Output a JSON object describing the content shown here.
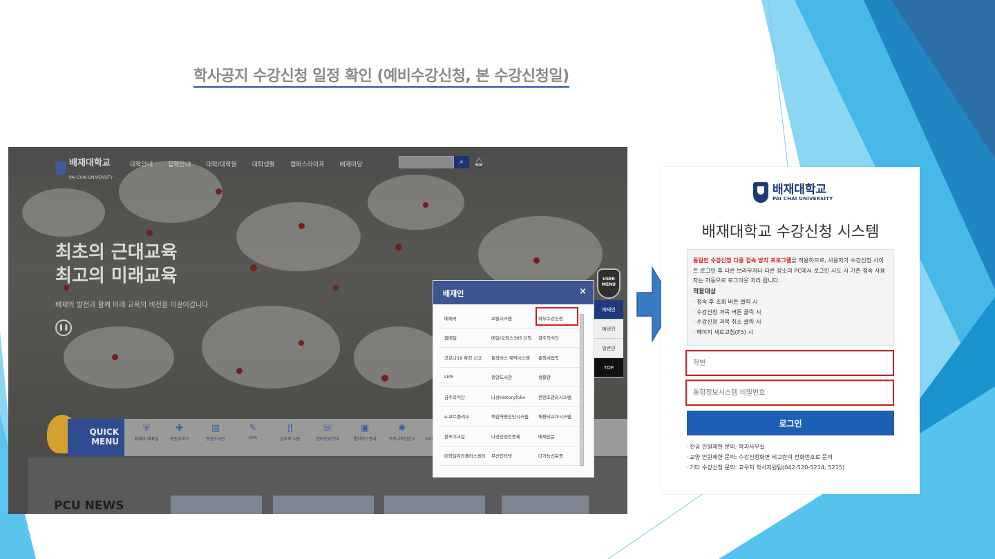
{
  "slide": {
    "title": "학사공지 수강신청 일정 확인 (예비수강신청, 본 수강신청일)"
  },
  "homepage": {
    "logo_name": "배재대학교",
    "logo_sub": "PAI CHAI UNIVERSITY",
    "nav": [
      "대학안내",
      "입학안내",
      "대학/대학원",
      "대학생활",
      "캠퍼스라이프",
      "배재마당"
    ],
    "hero_line1": "최초의 근대교육",
    "hero_line2": "최고의 미래교육",
    "hero_sub": "배재의 발전과 함께 미래 교육의 비전을 이끌어갑니다",
    "quick_menu": "QUICK MENU",
    "quick_items": [
      "배재주 대표일",
      "종합서비스",
      "종합도서관",
      "LMS",
      "금주의 식단",
      "전화번호안내",
      "통학버스안내",
      "코로나확진신고",
      "VR캠퍼스투어"
    ],
    "news_title": "PCU NEWS"
  },
  "popup": {
    "title": "배재인",
    "close": "×",
    "rows": [
      [
        "배재곡",
        "포털시스템",
        "학부수강신청"
      ],
      [
        "웹메일",
        "메일/오피스365 신청",
        "금주의식단"
      ],
      [
        "코로나19 확진 신고",
        "통학버스 예약시스템",
        "총행서법칙"
      ],
      [
        "LMS",
        "중앙도서관",
        "생활관"
      ],
      [
        "금주의식단",
        "나성Historyfolio",
        "콘텐츠관리시스템"
      ],
      [
        "e-포트폴리오",
        "핵심역량진단시스템",
        "채용비교과시스템"
      ],
      [
        "블쓰기교실",
        "나성인성인증제",
        "배재신문"
      ],
      [
        "대학일자리플러스센터",
        "무선인터넷",
        "다가능신문증"
      ]
    ],
    "side_tabs": [
      "배재인",
      "예비인",
      "일반인",
      "TOP"
    ],
    "user_menu": "USER MENU"
  },
  "login": {
    "logo_name": "배재대학교",
    "logo_sub": "PAI CHAI UNIVERSITY",
    "system_title": "배재대학교 수강신청 시스템",
    "notice_red": "동일인 수강신청 다중 접속 방지 프로그램",
    "notice_rest": "을 적용하므로, 사용자가 수강신청 사이트 로그인 후 다른 브라우저나 다른 장소의 PC에서 로그인 시도 시 기존 접속 사용자는 자동으로 로그아웃 처리 됩니다.",
    "notice_heading": "적용대상",
    "notice_items": [
      "· 접속 후 조회 버튼 클릭 시",
      "· 수강신청 과목 버튼 클릭 시",
      "· 수강신청 과목 취소 클릭 시",
      "· 페이지 새로고침(F5) 시"
    ],
    "id_placeholder": "학번",
    "pw_placeholder": "통합정보시스템 비밀번호",
    "login_label": "로그인",
    "footer": [
      "· 전공 인원제한 문의: 학과사무실",
      "· 교양 인원제한 문의: 수강신청화면 비고란의 전화번호로 문의",
      "· 기타 수강신청 문의: 교무처 학사지원팀(042-520-5214, 5215)"
    ]
  },
  "colors": {
    "accent_blue": "#1d5fb5",
    "highlight_red": "#d32222",
    "deco_light": "#5bc4ec",
    "deco_dark": "#1d8ac8"
  }
}
